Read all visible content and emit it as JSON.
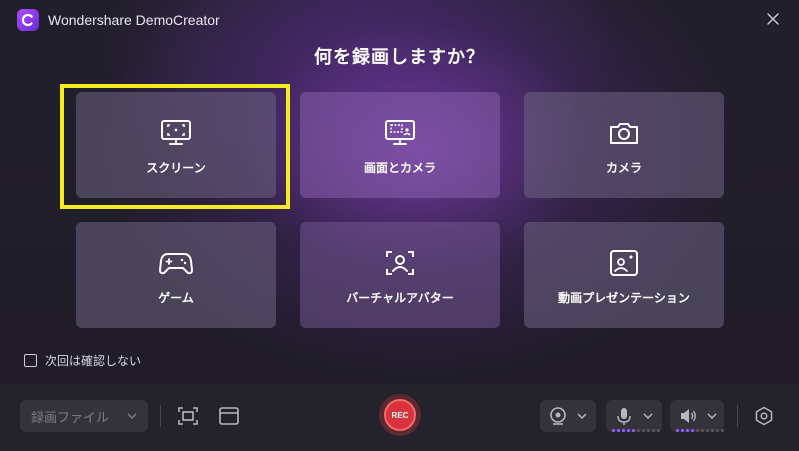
{
  "app": {
    "title": "Wondershare DemoCreator"
  },
  "heading": "何を録画しますか？",
  "cards": [
    {
      "label": "スクリーン",
      "icon": "screen-icon"
    },
    {
      "label": "画面とカメラ",
      "icon": "screen-camera-icon"
    },
    {
      "label": "カメラ",
      "icon": "camera-icon"
    },
    {
      "label": "ゲーム",
      "icon": "gamepad-icon"
    },
    {
      "label": "バーチャルアバター",
      "icon": "avatar-icon"
    },
    {
      "label": "動画プレゼンテーション",
      "icon": "presentation-icon"
    }
  ],
  "dont_ask": {
    "label": "次回は確認しない",
    "checked": false
  },
  "bottom": {
    "format_label": "録画ファイル",
    "rec_label": "REC"
  },
  "colors": {
    "highlight": "#f5ec1f",
    "rec": "#d8333a",
    "accent": "#8b5cf6"
  }
}
